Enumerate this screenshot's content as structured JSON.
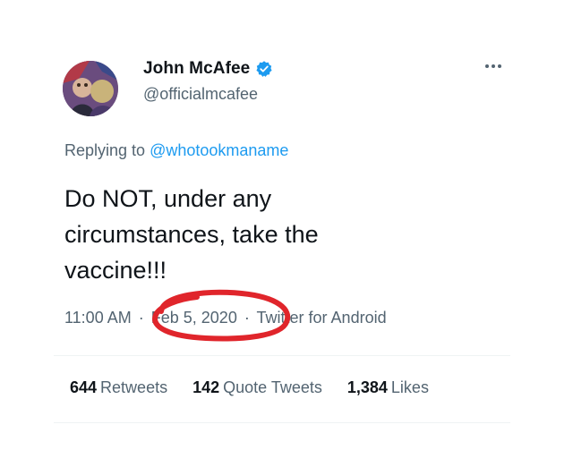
{
  "author": {
    "display_name": "John McAfee",
    "handle": "@officialmcafee"
  },
  "reply": {
    "prefix": "Replying to",
    "mention": "@whotookmaname"
  },
  "tweet": {
    "lines": [
      "Do NOT, under any",
      "circumstances, take the",
      "vaccine!!!"
    ]
  },
  "meta": {
    "time": "11:00 AM",
    "separator": "·",
    "date": "Feb 5, 2020",
    "source": "Twitter for Android"
  },
  "stats": {
    "retweets_count": "644",
    "retweets_label": "Retweets",
    "quotes_count": "142",
    "quotes_label": "Quote Tweets",
    "likes_count": "1,384",
    "likes_label": "Likes"
  },
  "icons": {
    "verified": "verified-badge-icon",
    "more": "more-options-icon"
  },
  "colors": {
    "text": "#0f1419",
    "secondary": "#536471",
    "link": "#1d9bf0",
    "verified": "#1d9bf0",
    "annotation": "#e0252b"
  }
}
